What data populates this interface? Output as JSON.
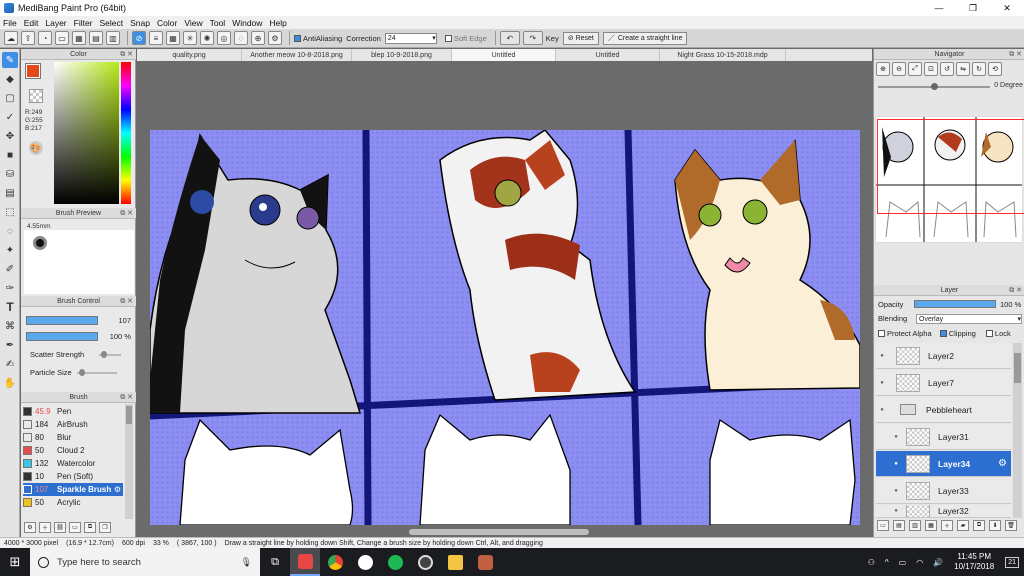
{
  "window": {
    "title": "MediBang Paint Pro (64bit)"
  },
  "menu": [
    "File",
    "Edit",
    "Layer",
    "Filter",
    "Select",
    "Snap",
    "Color",
    "View",
    "Tool",
    "Window",
    "Help"
  ],
  "toolbar": {
    "antialiasing_label": "AntiAliasing",
    "correction_label": "Correction",
    "correction_value": "24",
    "soft_edge_label": "Soft Edge",
    "key_label": "Key",
    "reset_label": "Reset",
    "straight_line_label": "Create a straight line"
  },
  "color_panel": {
    "title": "Color",
    "rgb_text": "R:249\nG:255\nB:217",
    "primary": "#e4491a",
    "hue_selected": "#b7ea1b"
  },
  "brush_preview": {
    "title": "Brush Preview",
    "size_text": "4.55mm"
  },
  "brush_control": {
    "title": "Brush Control",
    "size_value": "107",
    "opacity_value": "100 %",
    "scatter_label": "Scatter Strength",
    "particle_label": "Particle Size"
  },
  "brush_list": {
    "title": "Brush",
    "items": [
      {
        "size": "45.9",
        "name": "Pen",
        "color": "#333333"
      },
      {
        "size": "184",
        "name": "AirBrush",
        "color": "#e9e9e9"
      },
      {
        "size": "80",
        "name": "Blur",
        "color": "#e9e9e9"
      },
      {
        "size": "50",
        "name": "Cloud 2",
        "color": "#e84d4d"
      },
      {
        "size": "132",
        "name": "Watercolor",
        "color": "#36c7e6"
      },
      {
        "size": "10",
        "name": "Pen (Soft)",
        "color": "#333333"
      },
      {
        "size": "107",
        "name": "Sparkle Brush",
        "color": "#2c6fd1"
      },
      {
        "size": "50",
        "name": "Acrylic",
        "color": "#f2c21b"
      }
    ]
  },
  "tabs": [
    "quality.png",
    "Another meow 10-8-2018.png",
    "blep 10-9-2018.png",
    "Untitled",
    "Untitled",
    "Night Grass 10-15-2018.mdp"
  ],
  "navigator": {
    "title": "Navigator",
    "rotation": "0 Degree"
  },
  "layer_panel": {
    "title": "Layer",
    "opacity_label": "Opacity",
    "opacity_value": "100 %",
    "blending_label": "Blending",
    "blending_value": "Overlay",
    "protect_alpha_label": "Protect Alpha",
    "clipping_label": "Clipping",
    "lock_label": "Lock",
    "layers": [
      {
        "name": "Layer2",
        "type": "layer"
      },
      {
        "name": "Layer7",
        "type": "layer"
      },
      {
        "name": "Pebbleheart",
        "type": "folder"
      },
      {
        "name": "Layer31",
        "type": "layer"
      },
      {
        "name": "Layer34",
        "type": "layer",
        "selected": true
      },
      {
        "name": "Layer33",
        "type": "layer"
      },
      {
        "name": "Layer32",
        "type": "layer"
      }
    ]
  },
  "status": {
    "canvas_size": "4000 * 3000 pixel",
    "physical_size": "(16.9 * 12.7cm)",
    "dpi": "600 dpi",
    "zoom": "33 %",
    "coords": "( 3867, 100 )",
    "hint": "Draw a straight line by holding down Shift, Change a brush size by holding down Ctrl, Alt, and dragging"
  },
  "taskbar": {
    "search_placeholder": "Type here to search",
    "time": "11:45 PM",
    "date": "10/17/2018",
    "notification_count": "21"
  }
}
